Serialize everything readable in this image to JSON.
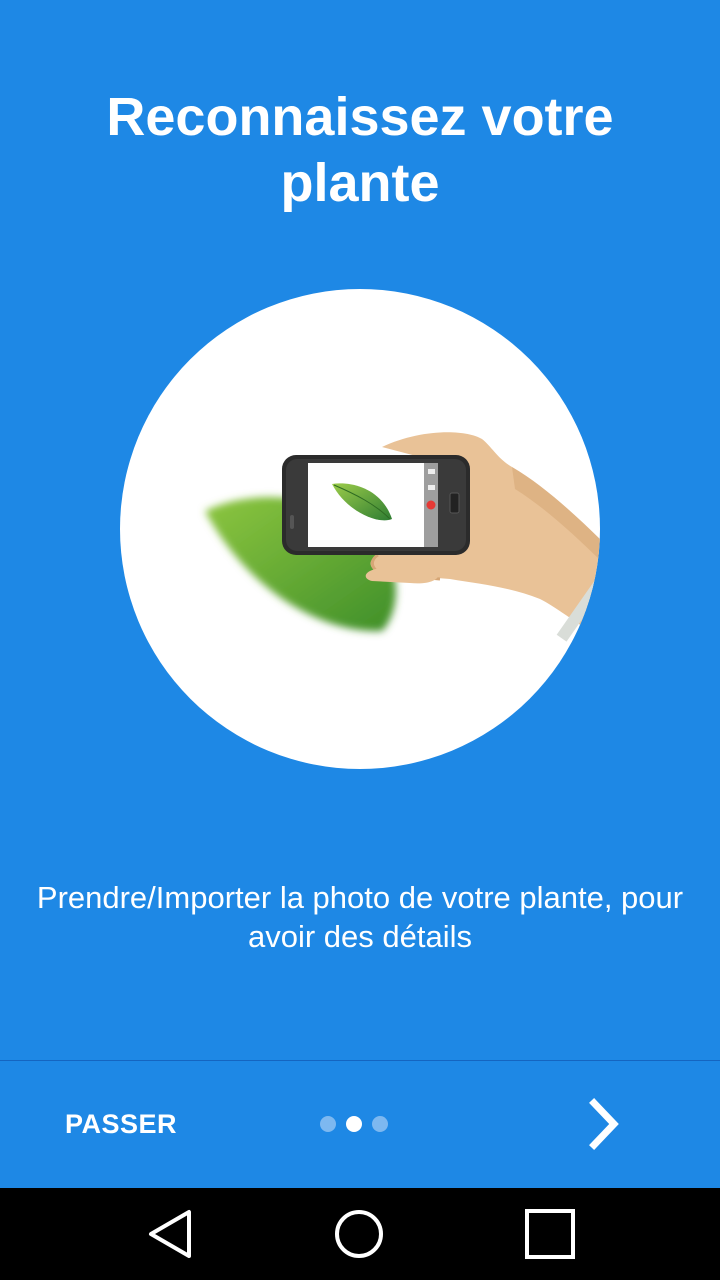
{
  "onboarding": {
    "title": "Reconnaissez votre plante",
    "description": "Prendre/Importer la photo de votre plante, pour avoir des détails",
    "illustration": "hand-holding-phone-photographing-leaf",
    "current_page": 2,
    "total_pages": 3
  },
  "bottom_bar": {
    "skip_label": "PASSER",
    "next_icon": "chevron-right-icon"
  },
  "navigation_bar": {
    "back_icon": "back-triangle-icon",
    "home_icon": "home-circle-icon",
    "recents_icon": "recents-square-icon"
  },
  "colors": {
    "background": "#1e88e5",
    "text": "#ffffff",
    "dot_inactive": "#7db8f0",
    "dot_active": "#ffffff",
    "navbar": "#000000"
  }
}
